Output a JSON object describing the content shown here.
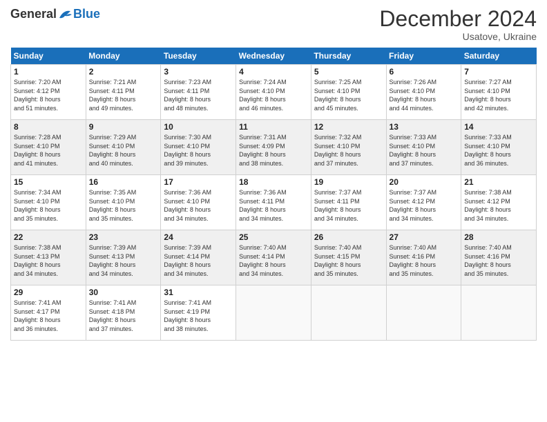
{
  "header": {
    "logo_general": "General",
    "logo_blue": "Blue",
    "month_title": "December 2024",
    "subtitle": "Usatove, Ukraine"
  },
  "days_of_week": [
    "Sunday",
    "Monday",
    "Tuesday",
    "Wednesday",
    "Thursday",
    "Friday",
    "Saturday"
  ],
  "weeks": [
    [
      {
        "day": "1",
        "lines": [
          "Sunrise: 7:20 AM",
          "Sunset: 4:12 PM",
          "Daylight: 8 hours",
          "and 51 minutes."
        ]
      },
      {
        "day": "2",
        "lines": [
          "Sunrise: 7:21 AM",
          "Sunset: 4:11 PM",
          "Daylight: 8 hours",
          "and 49 minutes."
        ]
      },
      {
        "day": "3",
        "lines": [
          "Sunrise: 7:23 AM",
          "Sunset: 4:11 PM",
          "Daylight: 8 hours",
          "and 48 minutes."
        ]
      },
      {
        "day": "4",
        "lines": [
          "Sunrise: 7:24 AM",
          "Sunset: 4:10 PM",
          "Daylight: 8 hours",
          "and 46 minutes."
        ]
      },
      {
        "day": "5",
        "lines": [
          "Sunrise: 7:25 AM",
          "Sunset: 4:10 PM",
          "Daylight: 8 hours",
          "and 45 minutes."
        ]
      },
      {
        "day": "6",
        "lines": [
          "Sunrise: 7:26 AM",
          "Sunset: 4:10 PM",
          "Daylight: 8 hours",
          "and 44 minutes."
        ]
      },
      {
        "day": "7",
        "lines": [
          "Sunrise: 7:27 AM",
          "Sunset: 4:10 PM",
          "Daylight: 8 hours",
          "and 42 minutes."
        ]
      }
    ],
    [
      {
        "day": "8",
        "lines": [
          "Sunrise: 7:28 AM",
          "Sunset: 4:10 PM",
          "Daylight: 8 hours",
          "and 41 minutes."
        ]
      },
      {
        "day": "9",
        "lines": [
          "Sunrise: 7:29 AM",
          "Sunset: 4:10 PM",
          "Daylight: 8 hours",
          "and 40 minutes."
        ]
      },
      {
        "day": "10",
        "lines": [
          "Sunrise: 7:30 AM",
          "Sunset: 4:10 PM",
          "Daylight: 8 hours",
          "and 39 minutes."
        ]
      },
      {
        "day": "11",
        "lines": [
          "Sunrise: 7:31 AM",
          "Sunset: 4:09 PM",
          "Daylight: 8 hours",
          "and 38 minutes."
        ]
      },
      {
        "day": "12",
        "lines": [
          "Sunrise: 7:32 AM",
          "Sunset: 4:10 PM",
          "Daylight: 8 hours",
          "and 37 minutes."
        ]
      },
      {
        "day": "13",
        "lines": [
          "Sunrise: 7:33 AM",
          "Sunset: 4:10 PM",
          "Daylight: 8 hours",
          "and 37 minutes."
        ]
      },
      {
        "day": "14",
        "lines": [
          "Sunrise: 7:33 AM",
          "Sunset: 4:10 PM",
          "Daylight: 8 hours",
          "and 36 minutes."
        ]
      }
    ],
    [
      {
        "day": "15",
        "lines": [
          "Sunrise: 7:34 AM",
          "Sunset: 4:10 PM",
          "Daylight: 8 hours",
          "and 35 minutes."
        ]
      },
      {
        "day": "16",
        "lines": [
          "Sunrise: 7:35 AM",
          "Sunset: 4:10 PM",
          "Daylight: 8 hours",
          "and 35 minutes."
        ]
      },
      {
        "day": "17",
        "lines": [
          "Sunrise: 7:36 AM",
          "Sunset: 4:10 PM",
          "Daylight: 8 hours",
          "and 34 minutes."
        ]
      },
      {
        "day": "18",
        "lines": [
          "Sunrise: 7:36 AM",
          "Sunset: 4:11 PM",
          "Daylight: 8 hours",
          "and 34 minutes."
        ]
      },
      {
        "day": "19",
        "lines": [
          "Sunrise: 7:37 AM",
          "Sunset: 4:11 PM",
          "Daylight: 8 hours",
          "and 34 minutes."
        ]
      },
      {
        "day": "20",
        "lines": [
          "Sunrise: 7:37 AM",
          "Sunset: 4:12 PM",
          "Daylight: 8 hours",
          "and 34 minutes."
        ]
      },
      {
        "day": "21",
        "lines": [
          "Sunrise: 7:38 AM",
          "Sunset: 4:12 PM",
          "Daylight: 8 hours",
          "and 34 minutes."
        ]
      }
    ],
    [
      {
        "day": "22",
        "lines": [
          "Sunrise: 7:38 AM",
          "Sunset: 4:13 PM",
          "Daylight: 8 hours",
          "and 34 minutes."
        ]
      },
      {
        "day": "23",
        "lines": [
          "Sunrise: 7:39 AM",
          "Sunset: 4:13 PM",
          "Daylight: 8 hours",
          "and 34 minutes."
        ]
      },
      {
        "day": "24",
        "lines": [
          "Sunrise: 7:39 AM",
          "Sunset: 4:14 PM",
          "Daylight: 8 hours",
          "and 34 minutes."
        ]
      },
      {
        "day": "25",
        "lines": [
          "Sunrise: 7:40 AM",
          "Sunset: 4:14 PM",
          "Daylight: 8 hours",
          "and 34 minutes."
        ]
      },
      {
        "day": "26",
        "lines": [
          "Sunrise: 7:40 AM",
          "Sunset: 4:15 PM",
          "Daylight: 8 hours",
          "and 35 minutes."
        ]
      },
      {
        "day": "27",
        "lines": [
          "Sunrise: 7:40 AM",
          "Sunset: 4:16 PM",
          "Daylight: 8 hours",
          "and 35 minutes."
        ]
      },
      {
        "day": "28",
        "lines": [
          "Sunrise: 7:40 AM",
          "Sunset: 4:16 PM",
          "Daylight: 8 hours",
          "and 35 minutes."
        ]
      }
    ],
    [
      {
        "day": "29",
        "lines": [
          "Sunrise: 7:41 AM",
          "Sunset: 4:17 PM",
          "Daylight: 8 hours",
          "and 36 minutes."
        ]
      },
      {
        "day": "30",
        "lines": [
          "Sunrise: 7:41 AM",
          "Sunset: 4:18 PM",
          "Daylight: 8 hours",
          "and 37 minutes."
        ]
      },
      {
        "day": "31",
        "lines": [
          "Sunrise: 7:41 AM",
          "Sunset: 4:19 PM",
          "Daylight: 8 hours",
          "and 38 minutes."
        ]
      },
      null,
      null,
      null,
      null
    ]
  ]
}
